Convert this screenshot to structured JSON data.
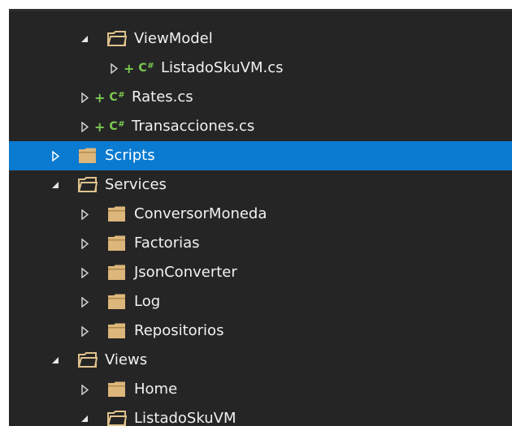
{
  "tree": {
    "rows": [
      {
        "label": "ViewModel",
        "kind": "folder",
        "expanded": true,
        "level": 2
      },
      {
        "label": "ListadoSkuVM.cs",
        "kind": "csharp-file",
        "expanded": false,
        "level": 3,
        "status": "+",
        "badge": "C#"
      },
      {
        "label": "Rates.cs",
        "kind": "csharp-file",
        "expanded": false,
        "level": 2,
        "status": "+",
        "badge": "C#"
      },
      {
        "label": "Transacciones.cs",
        "kind": "csharp-file",
        "expanded": false,
        "level": 2,
        "status": "+",
        "badge": "C#"
      },
      {
        "label": "Scripts",
        "kind": "folder",
        "expanded": false,
        "level": 1,
        "selected": true
      },
      {
        "label": "Services",
        "kind": "folder",
        "expanded": true,
        "level": 1
      },
      {
        "label": "ConversorMoneda",
        "kind": "folder",
        "expanded": false,
        "level": 2
      },
      {
        "label": "Factorias",
        "kind": "folder",
        "expanded": false,
        "level": 2
      },
      {
        "label": "JsonConverter",
        "kind": "folder",
        "expanded": false,
        "level": 2
      },
      {
        "label": "Log",
        "kind": "folder",
        "expanded": false,
        "level": 2
      },
      {
        "label": "Repositorios",
        "kind": "folder",
        "expanded": false,
        "level": 2
      },
      {
        "label": "Views",
        "kind": "folder",
        "expanded": true,
        "level": 1
      },
      {
        "label": "Home",
        "kind": "folder",
        "expanded": false,
        "level": 2
      },
      {
        "label": "ListadoSkuVM",
        "kind": "folder",
        "expanded": true,
        "level": 2
      }
    ]
  },
  "colors": {
    "background": "#252526",
    "selection": "#0b7ad1",
    "text": "#f1f1f1",
    "folder": "#dcb67a",
    "csharp": "#7cc94f",
    "arrow": "#d0d0d0"
  }
}
